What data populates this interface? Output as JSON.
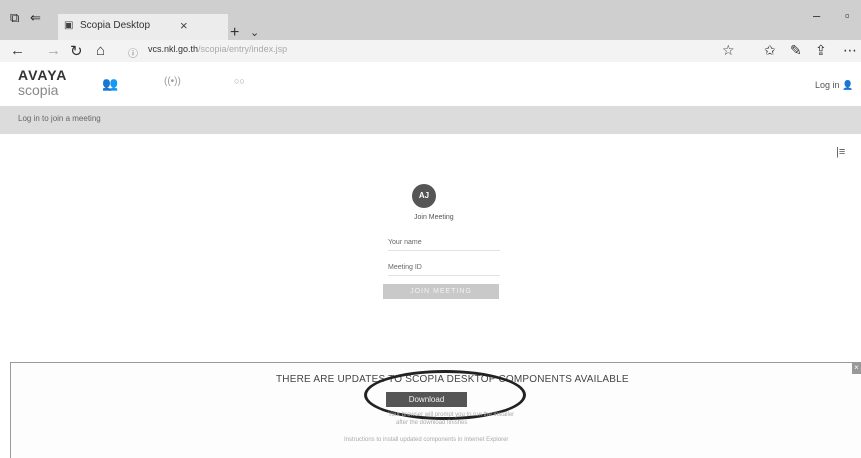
{
  "browser": {
    "tab_title": "Scopia Desktop",
    "tab_close": "×",
    "new_tab": "+",
    "tab_menu": "⌄",
    "url_host": "vcs.nkl.go.th",
    "url_rest": "/scopia/entry/index.jsp",
    "window_min": "–",
    "window_max": "▫"
  },
  "app": {
    "brand": "AVAYA",
    "product": "scopia",
    "nav": {
      "people": "👥",
      "broadcast": "((•))",
      "other": "○○"
    },
    "login_label": "Log in"
  },
  "subbar": {
    "text": "Log in to join a meeting"
  },
  "join_form": {
    "avatar_initials": "AJ",
    "title": "Join Meeting",
    "name_placeholder": "Your name",
    "meeting_id_placeholder": "Meeting ID",
    "join_button": "JOIN MEETING"
  },
  "update_panel": {
    "title": "THERE ARE UPDATES TO SCOPIA DESKTOP COMPONENTS AVAILABLE",
    "download_button": "Download",
    "note_line1": "Your browser will prompt you to run the installer",
    "note_line2": "after the download finishes",
    "note_line3": "Instructions to install updated components in Internet Explorer",
    "close": "×"
  }
}
